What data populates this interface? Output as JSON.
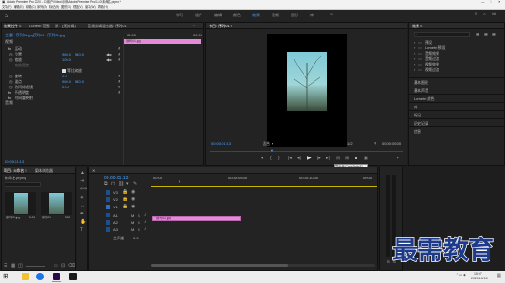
{
  "window": {
    "title": "Adobe Premiere Pro 2020 - C:\\用户\\Video\\示例\\Adobe Premiere Pro\\14.0\\未命名.prproj *"
  },
  "menu": [
    "文件(F)",
    "编辑(E)",
    "剪辑(C)",
    "序列(S)",
    "标记(M)",
    "图形(G)",
    "视图(V)",
    "窗口(W)",
    "帮助(H)"
  ],
  "workspace_tabs": [
    "学习",
    "组件",
    "编辑",
    "颜色",
    "效果",
    "音频",
    "图形",
    "库"
  ],
  "workspace_active": "效果",
  "effect_controls": {
    "tabs": [
      "效果控件 ≡",
      "Lumetri 范围",
      "源：(无剪辑)",
      "音频剪辑混合器: 序列01"
    ],
    "source": "主要 * 序列01.jpg",
    "sequence": "序列01 * 序列01.jpg",
    "time_start": "00:00",
    "time_end": "00:00",
    "clip_label": "序列01.jpg",
    "section_video": "视频",
    "section_audio": "音频",
    "rows": [
      {
        "name": "运动",
        "value1": "",
        "value2": ""
      },
      {
        "name": "位置",
        "value1": "960.0",
        "value2": "540.0"
      },
      {
        "name": "缩放",
        "value1": "100.0",
        "value2": ""
      },
      {
        "name": "缩放宽度",
        "value1": "",
        "value2": ""
      },
      {
        "name": "等比缩放",
        "value1": "",
        "value2": ""
      },
      {
        "name": "旋转",
        "value1": "0.0",
        "value2": ""
      },
      {
        "name": "锚点",
        "value1": "960.0",
        "value2": "540.0"
      },
      {
        "name": "防闪烁滤镜",
        "value1": "0.00",
        "value2": ""
      },
      {
        "name": "不透明度",
        "value1": "",
        "value2": ""
      },
      {
        "name": "时间重映射",
        "value1": "",
        "value2": ""
      }
    ],
    "uniform_scale_label": "等比缩放",
    "bottom_time": "00:00:01:13"
  },
  "program_monitor": {
    "tab": "节目: 序列01 ≡",
    "timecode": "00:00:01:13",
    "fit": "适合",
    "ratio": "1/2",
    "duration": "00:00:05:00",
    "tooltip": "导出帧 (Ctrl+Shift+E)"
  },
  "right_panel": {
    "title": "效果 ≡",
    "tree": [
      "预设",
      "Lumetri 预设",
      "音频效果",
      "音频过渡",
      "视频效果",
      "视频过渡"
    ],
    "sections": [
      "基本图形",
      "基本声音",
      "Lumetri 颜色",
      "库",
      "标记",
      "历史记录",
      "信息"
    ]
  },
  "project": {
    "tabs": [
      "项目: 未命名 ≡",
      "媒体浏览器"
    ],
    "path": "未命名.prproj",
    "items": [
      {
        "name": "序列01.jpg",
        "meta": "5:00"
      },
      {
        "name": "序列01",
        "meta": "5:00"
      }
    ]
  },
  "timeline": {
    "timecode": "00:00:01:13",
    "ruler": [
      "00:00",
      "00:00:05:00",
      "00:00:10:00",
      "00:00"
    ],
    "tracks": [
      "V3",
      "V2",
      "V1",
      "A1",
      "A2",
      "A3",
      "主声道"
    ],
    "clip_label": "序列01.jpg",
    "master_value": "0.0"
  },
  "taskbar": {
    "time": "15:07",
    "date": "2021/10/18"
  },
  "watermark": "最需教育",
  "colors": {
    "accent": "#4aa3ff",
    "clip": "#e38ad8",
    "bg": "#1e1e1e",
    "panel": "#232323"
  }
}
